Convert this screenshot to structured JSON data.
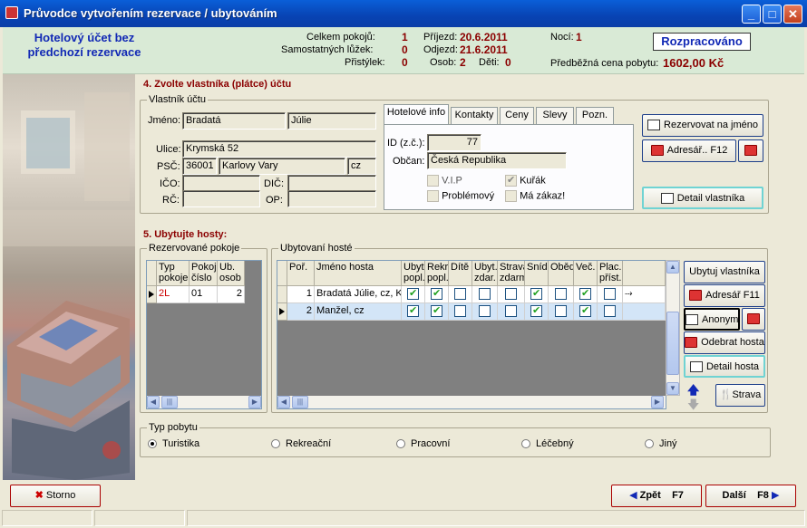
{
  "window": {
    "title": "Průvodce vytvořením rezervace / ubytováním"
  },
  "header": {
    "title": "Hotelový účet bez předchozí rezervace",
    "celkem_pokoju_label": "Celkem pokojů:",
    "celkem_pokoju": "1",
    "samostatnych_luzek_label": "Samostatných lůžek:",
    "samostatnych_luzek": "0",
    "pristylek_label": "Přistýlek:",
    "pristylek": "0",
    "prijezd_label": "Příjezd:",
    "prijezd": "20.6.2011",
    "odjezd_label": "Odjezd:",
    "odjezd": "21.6.2011",
    "osob_label": "Osob:",
    "osob": "2",
    "deti_label": "Děti:",
    "deti": "0",
    "noci_label": "Nocí:",
    "noci": "1",
    "status": "Rozpracováno",
    "cena_label": "Předběžná cena pobytu:",
    "cena": "1602,00 Kč"
  },
  "owner": {
    "section_title": "4. Zvolte vlastníka (plátce) účtu",
    "group_label": "Vlastník účtu",
    "jmeno_label": "Jméno:",
    "prijmeni": "Bradatá",
    "jmeno": "Júlie",
    "ulice_label": "Ulice:",
    "ulice": "Krymská 52",
    "psc_label": "PSČ:",
    "psc": "36001",
    "mesto": "Karlovy Vary",
    "stat": "cz",
    "ico_label": "IČO:",
    "ico": "",
    "dic_label": "DIČ:",
    "dic": "",
    "rc_label": "RČ:",
    "rc": "",
    "op_label": "OP:",
    "op": "",
    "tabs": [
      "Hotelové info",
      "Kontakty",
      "Ceny",
      "Slevy",
      "Pozn."
    ],
    "id_label": "ID (z.č.):",
    "id": "77",
    "obcan_label": "Občan:",
    "obcan": "Česká Republika",
    "vip_label": "V.I.P",
    "vip": false,
    "kurak_label": "Kuřák",
    "kurak": true,
    "problemovy_label": "Problémový",
    "problemovy": false,
    "ma_zakaz_label": "Má zákaz!",
    "ma_zakaz": false,
    "rezervovat_button": "Rezervovat na jméno",
    "adresar_button": "Adresář.. F12",
    "detail_button": "Detail vlastníka"
  },
  "guests": {
    "section_title": "5. Ubytujte hosty:",
    "rooms_label": "Rezervované pokoje",
    "rooms_columns": [
      "Typ pokoje",
      "Pokoj číslo",
      "Ub. osob"
    ],
    "rooms_rows": [
      [
        "2L",
        "01",
        "2"
      ]
    ],
    "guests_label": "Ubytovaní hosté",
    "guest_columns": [
      "Poř.",
      "Jméno hosta",
      "Ubyt. popl.",
      "Rekr. popl.",
      "Dítě",
      "Ubyt. zdar.",
      "Strava zdarma",
      "Sníd.",
      "Oběd",
      "Več.",
      "Plac. příst."
    ],
    "guest_rows": [
      {
        "por": "1",
        "name": "Bradatá Júlie, cz, Ka",
        "checks": [
          true,
          true,
          false,
          false,
          false,
          true,
          false,
          true,
          false
        ]
      },
      {
        "por": "2",
        "name": "Manžel, cz",
        "checks": [
          true,
          true,
          false,
          false,
          false,
          true,
          false,
          true,
          false
        ]
      }
    ],
    "ubytuj_button": "Ubytuj vlastníka",
    "adresar_button": "Adresář F11",
    "anonym_button": "Anonym",
    "odebrat_button": "Odebrat hosta",
    "detail_button": "Detail hosta",
    "strava_button": "Strava"
  },
  "stay": {
    "label": "Typ pobytu",
    "options": [
      "Turistika",
      "Rekreační",
      "Pracovní",
      "Léčebný",
      "Jiný"
    ],
    "selected": "Turistika"
  },
  "footer": {
    "storno_button": "Storno",
    "zpet_button": "Zpět",
    "zpet_key": "F7",
    "dalsi_button": "Další",
    "dalsi_key": "F8"
  }
}
